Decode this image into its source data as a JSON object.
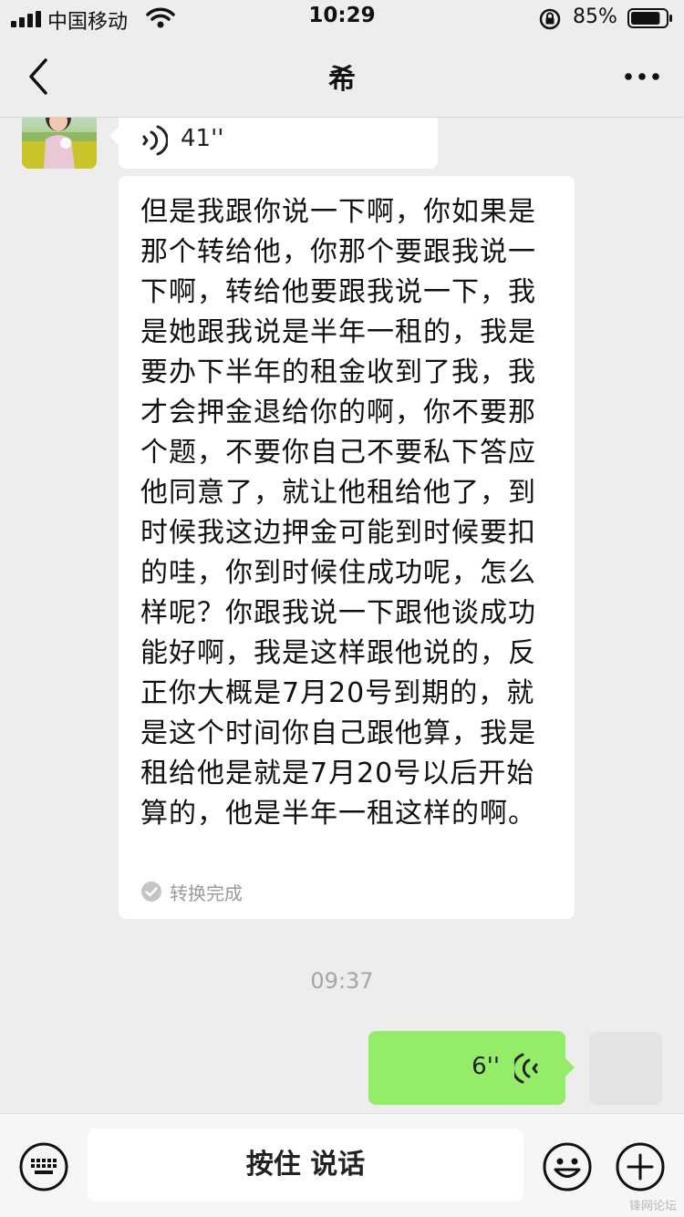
{
  "status_bar": {
    "carrier": "中国移动",
    "time": "10:29",
    "battery": "85%",
    "battery_level": 0.85
  },
  "nav": {
    "title": "希",
    "back_icon": "chevron-left-icon",
    "more_icon": "more-dots-icon"
  },
  "messages": {
    "incoming_voice_duration": "41''",
    "transcript": "但是我跟你说一下啊，你如果是那个转给他，你那个要跟我说一下啊，转给他要跟我说一下，我是她跟我说是半年一租的，我是要办下半年的租金收到了我，我才会押金退给你的啊，你不要那个题，不要你自己不要私下答应他同意了，就让他租给他了，到时候我这边押金可能到时候要扣的哇，你到时候住成功呢，怎么样呢？你跟我说一下跟他谈成功能好啊，我是这样跟他说的，反正你大概是7月20号到期的，就是这个时间你自己跟他算，我是租给他是就是7月20号以后开始算的，他是半年一租这样的啊。",
    "transcript_status": "转换完成",
    "timestamp": "09:37",
    "outgoing_voice_duration": "6''"
  },
  "input_bar": {
    "hold_to_talk": "按住 说话"
  },
  "watermark": "锋网论坛",
  "colors": {
    "background": "#ededed",
    "outgoing_bubble": "#95ec69",
    "incoming_bubble": "#ffffff"
  }
}
